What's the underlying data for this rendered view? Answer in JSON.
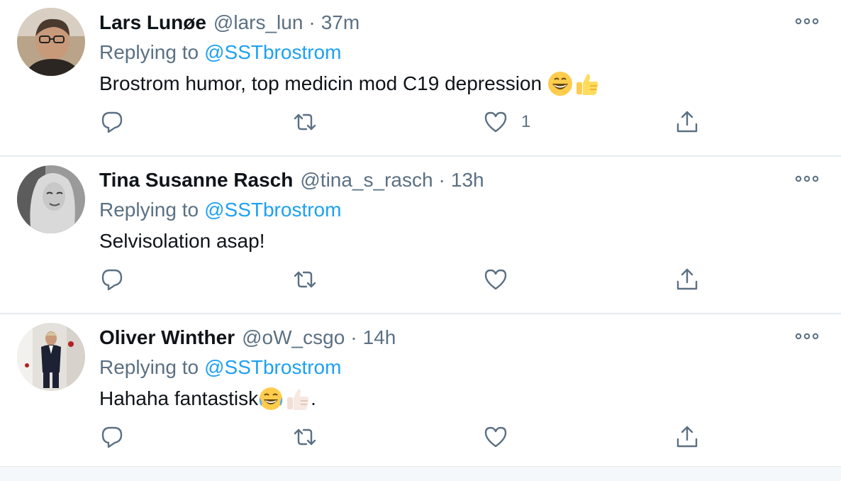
{
  "tweets": [
    {
      "display_name": "Lars Lunøe",
      "handle": "@lars_lun",
      "separator": "·",
      "time": "37m",
      "replying_prefix": "Replying to",
      "replying_to": "@SSTbrostrom",
      "text": "Brostrom humor, top medicin mod C19 depression ",
      "trailing_text": "",
      "emojis": [
        "grinning-face-emoji",
        "thumbs-up-emoji"
      ],
      "like_count": "1"
    },
    {
      "display_name": "Tina Susanne Rasch",
      "handle": "@tina_s_rasch",
      "separator": "·",
      "time": "13h",
      "replying_prefix": "Replying to",
      "replying_to": "@SSTbrostrom",
      "text": "Selvisolation asap!",
      "trailing_text": "",
      "emojis": [],
      "like_count": ""
    },
    {
      "display_name": "Oliver Winther",
      "handle": "@oW_csgo",
      "separator": "·",
      "time": "14h",
      "replying_prefix": "Replying to",
      "replying_to": "@SSTbrostrom",
      "text": "Hahaha fantastisk",
      "trailing_text": ".",
      "emojis": [
        "tears-of-joy-emoji",
        "thumbs-up-light-emoji"
      ],
      "like_count": ""
    }
  ],
  "icons": {
    "reply": "reply-icon",
    "retweet": "retweet-icon",
    "like": "heart-icon",
    "share": "share-icon",
    "more": "more-icon"
  },
  "colors": {
    "link": "#1da1f2",
    "secondary_text": "#5b7083",
    "primary_text": "#0f1419",
    "divider": "#e6ecf0"
  }
}
